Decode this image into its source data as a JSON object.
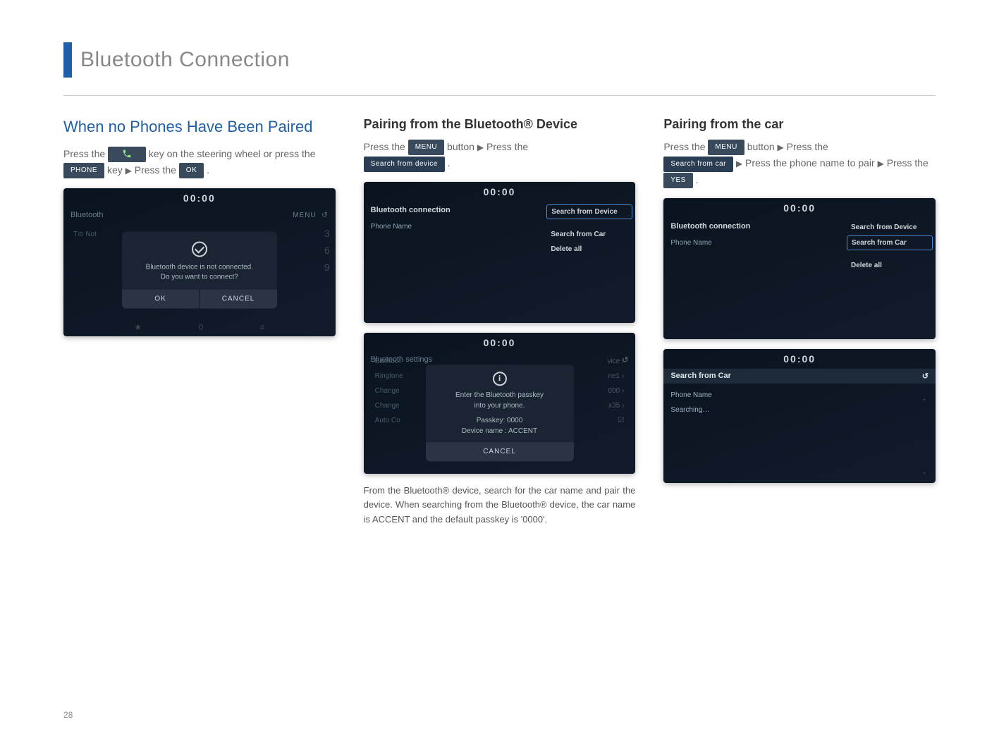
{
  "pageTitle": "Bluetooth Connection",
  "pageNumber": "28",
  "arrowGlyph": "▶",
  "col1": {
    "heading": "When no Phones Have Been Paired",
    "line1_a": "Press the ",
    "line1_b": " key on the steering wheel or press the ",
    "line1_c": " key ",
    "line1_d": " Press the ",
    "line1_e": " .",
    "btn_phone": "PHONE",
    "btn_ok": "OK",
    "device": {
      "clock": "00:00",
      "hdr_left": "Bluetooth",
      "hdr_menu": "MENU",
      "not_label": "T⊙  Not",
      "dialog_l1": "Bluetooth device is not connected.",
      "dialog_l2": "Do you want to connect?",
      "dlg_ok": "OK",
      "dlg_cancel": "CANCEL",
      "nums": [
        "3",
        "6",
        "9"
      ],
      "bottom": [
        "★",
        "0",
        "#"
      ]
    }
  },
  "col2": {
    "heading": "Pairing from the Bluetooth® Device",
    "line1_a": "Press the ",
    "line1_b": " button ",
    "line1_c": " Press the ",
    "line1_d": " .",
    "btn_menu": "MENU",
    "btn_sfd": "Search from device",
    "devB": {
      "clock": "00:00",
      "hdr": "Bluetooth connection",
      "item": "Phone Name",
      "menu": [
        "Search from Device",
        "Search from Car",
        "Delete all"
      ]
    },
    "devC": {
      "clock": "00:00",
      "settings_title": "Bluetooth settings",
      "rows": [
        {
          "l": "Bluetoot",
          "r": "vice"
        },
        {
          "l": "Ringtone",
          "r": "ne1"
        },
        {
          "l": "Change",
          "r": "000"
        },
        {
          "l": "Change",
          "r": "x35"
        },
        {
          "l": "Auto Co",
          "r": ""
        }
      ],
      "info_l1": "Enter the Bluetooth passkey",
      "info_l2": "into your phone.",
      "info_l3": "Passkey: 0000",
      "info_l4": "Device name : ACCENT",
      "cancel": "CANCEL"
    },
    "para": "From the Bluetooth® device, search for the car name and pair the device. When searching from the Bluetooth® device, the car name is ACCENT and the default passkey is '0000'."
  },
  "col3": {
    "heading": "Pairing from the car",
    "line1_a": "Press the ",
    "line1_b": " button ",
    "line1_c": " Press the ",
    "line1_d": " ",
    "line1_e": " Press the phone name to pair ",
    "line1_f": " Press the ",
    "line1_g": " .",
    "btn_menu": "MENU",
    "btn_sfc": "Search from car",
    "btn_yes": "YES",
    "devB": {
      "clock": "00:00",
      "hdr": "Bluetooth connection",
      "item": "Phone Name",
      "menu": [
        "Search from Device",
        "Search from Car",
        "Delete all"
      ]
    },
    "devD": {
      "clock": "00:00",
      "hdr": "Search from Car",
      "rows": [
        "Phone Name",
        "Searching…"
      ]
    }
  }
}
